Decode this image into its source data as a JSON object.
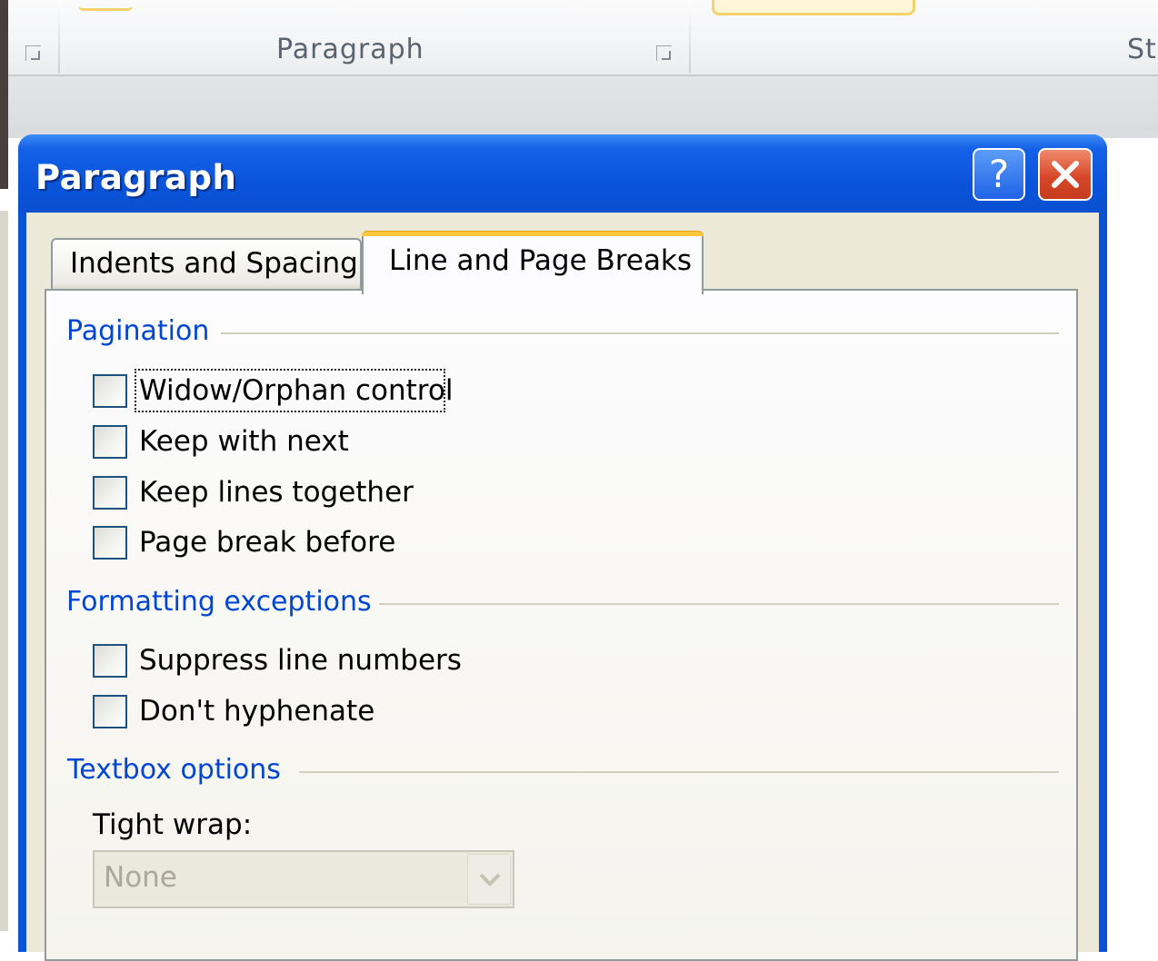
{
  "ribbon": {
    "paragraph_group_label": "Paragraph",
    "styles_group_label": "St",
    "launcher_icon": "dialog-launcher-icon"
  },
  "dialog": {
    "title": "Paragraph",
    "help_icon": "help-icon",
    "help_label": "?",
    "close_icon": "close-icon",
    "tabs": [
      {
        "label": "Indents and Spacing",
        "selected": false
      },
      {
        "label": "Line and Page Breaks",
        "selected": true
      }
    ],
    "pagination": {
      "header": "Pagination",
      "options": [
        {
          "label": "Widow/Orphan control",
          "checked": false,
          "focused": true
        },
        {
          "label": "Keep with next",
          "checked": false
        },
        {
          "label": "Keep lines together",
          "checked": false
        },
        {
          "label": "Page break before",
          "checked": false
        }
      ]
    },
    "formatting_exceptions": {
      "header": "Formatting exceptions",
      "options": [
        {
          "label": "Suppress line numbers",
          "checked": false
        },
        {
          "label": "Don't hyphenate",
          "checked": false
        }
      ]
    },
    "textbox_options": {
      "header": "Textbox options",
      "tight_wrap_label": "Tight wrap:",
      "tight_wrap_value": "None",
      "tight_wrap_enabled": false,
      "dropdown_icon": "chevron-down-icon"
    }
  },
  "colors": {
    "title_bar": "#0a52d6",
    "group_header": "#0046d5",
    "selected_tab_accent": "#ffc83c",
    "close_button": "#d8482a"
  }
}
